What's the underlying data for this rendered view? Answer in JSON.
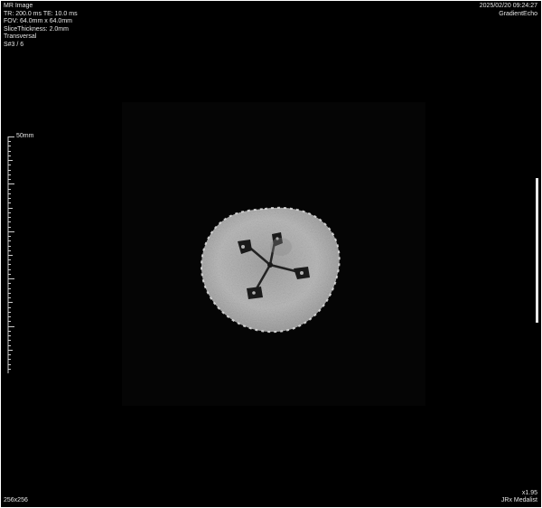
{
  "overlay_top_left": [
    "MR Image",
    "TR: 200.0 ms   TE: 10.0 ms",
    "FOV: 64.0mm x 64.0mm",
    "SliceThickness: 2.0mm",
    "Transversal",
    "S#3 / 6"
  ],
  "overlay_top_right": [
    "2025/02/20 09:24:27",
    "GradientEcho"
  ],
  "overlay_bottom_left": "256x256",
  "overlay_bottom_right": [
    "x1.95",
    "JRx Medalist"
  ],
  "scale_bar": {
    "label": "50mm"
  },
  "colors": {
    "background": "#000000",
    "overlay_text": "#e6e6e6",
    "specimen": "#b9b9b9"
  }
}
